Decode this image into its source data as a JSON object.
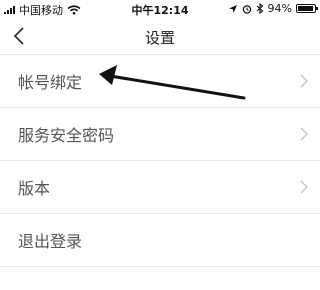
{
  "status_bar": {
    "carrier": "中国移动",
    "time": "中午12:14",
    "battery": "94%",
    "battery_level": 0.94
  },
  "nav": {
    "title": "设置",
    "back_icon": "chevron-left-icon"
  },
  "items": [
    {
      "label": "帐号绑定",
      "has_chevron": true
    },
    {
      "label": "服务安全密码",
      "has_chevron": true
    },
    {
      "label": "版本",
      "has_chevron": true
    },
    {
      "label": "退出登录",
      "has_chevron": false
    }
  ],
  "annotation": {
    "icon": "annotation-arrow",
    "color": "#111111"
  }
}
